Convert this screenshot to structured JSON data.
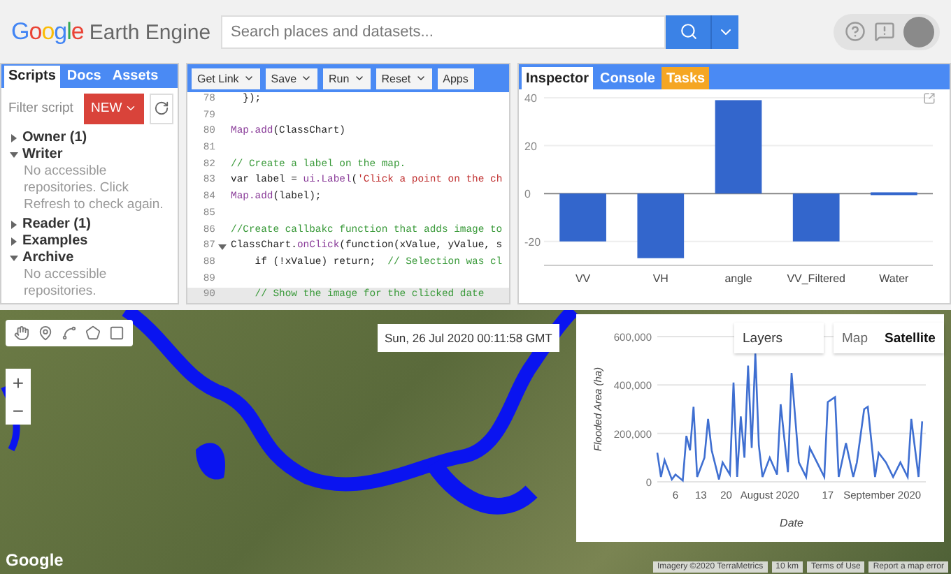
{
  "header": {
    "logo": {
      "brand": "Google",
      "product": "Earth Engine"
    },
    "search": {
      "placeholder": "Search places and datasets..."
    }
  },
  "left_panel": {
    "tabs": [
      {
        "label": "Scripts",
        "selected": true
      },
      {
        "label": "Docs",
        "selected": false
      },
      {
        "label": "Assets",
        "selected": false
      }
    ],
    "filter": {
      "placeholder": "Filter script"
    },
    "new_button": "NEW",
    "tree": [
      {
        "label": "Owner (1)",
        "expanded": false
      },
      {
        "label": "Writer",
        "expanded": true,
        "note": "No accessible repositories. Click Refresh to check again."
      },
      {
        "label": "Reader (1)",
        "expanded": false
      },
      {
        "label": "Examples",
        "expanded": false
      },
      {
        "label": "Archive",
        "expanded": true,
        "note": "No accessible repositories."
      }
    ]
  },
  "editor": {
    "toolbar": [
      {
        "label": "Get Link",
        "dropdown": true
      },
      {
        "label": "Save",
        "dropdown": true
      },
      {
        "label": "Run",
        "dropdown": true
      },
      {
        "label": "Reset",
        "dropdown": true
      },
      {
        "label": "Apps",
        "dropdown": false
      }
    ],
    "lines": [
      {
        "num": "78",
        "segments": [
          {
            "text": "  });",
            "kind": "plain"
          }
        ]
      },
      {
        "num": "79"
      },
      {
        "num": "80",
        "segments": [
          {
            "text": "Map.add",
            "kind": "builtin"
          },
          {
            "text": "(ClassChart)",
            "kind": "plain"
          }
        ]
      },
      {
        "num": "81"
      },
      {
        "num": "82",
        "segments": [
          {
            "text": "// Create a label on the map.",
            "kind": "comment"
          }
        ]
      },
      {
        "num": "83",
        "segments": [
          {
            "text": "var label = ",
            "kind": "plain"
          },
          {
            "text": "ui.Label",
            "kind": "builtin"
          },
          {
            "text": "(",
            "kind": "plain"
          },
          {
            "text": "'Click a point on the ch",
            "kind": "string"
          }
        ]
      },
      {
        "num": "84",
        "segments": [
          {
            "text": "Map.add",
            "kind": "builtin"
          },
          {
            "text": "(label);",
            "kind": "plain"
          }
        ]
      },
      {
        "num": "85"
      },
      {
        "num": "86",
        "segments": [
          {
            "text": "//Create callbakc function that adds image to",
            "kind": "comment"
          }
        ]
      },
      {
        "num": "87",
        "foldable": true,
        "segments": [
          {
            "text": "ClassChart.",
            "kind": "plain"
          },
          {
            "text": "onClick",
            "kind": "builtin"
          },
          {
            "text": "(function(xValue, yValue, s",
            "kind": "plain"
          }
        ]
      },
      {
        "num": "88",
        "segments": [
          {
            "text": "    if (!xValue) return;  ",
            "kind": "plain"
          },
          {
            "text": "// Selection was cl",
            "kind": "comment"
          }
        ]
      },
      {
        "num": "89"
      },
      {
        "num": "90",
        "current": true,
        "segments": [
          {
            "text": "    // Show the image for the clicked date",
            "kind": "comment"
          }
        ]
      }
    ]
  },
  "right_panel": {
    "tabs": [
      {
        "label": "Inspector",
        "selected": true,
        "alert": false
      },
      {
        "label": "Console",
        "selected": false,
        "alert": false
      },
      {
        "label": "Tasks",
        "selected": false,
        "alert": true
      }
    ],
    "chart_data": {
      "type": "bar",
      "categories": [
        "VV",
        "VH",
        "angle",
        "VV_Filtered",
        "Water"
      ],
      "values": [
        -20,
        -27,
        39,
        -20,
        0.5
      ],
      "ylim": [
        -30,
        40
      ],
      "yticks": [
        -20,
        0,
        20,
        40
      ]
    }
  },
  "map": {
    "date": "Sun, 26 Jul 2020 00:11:58 GMT",
    "zoom_in": "+",
    "zoom_out": "−",
    "layers": "Layers",
    "map_types": [
      {
        "label": "Map",
        "selected": false
      },
      {
        "label": "Satellite",
        "selected": true
      }
    ],
    "google_logo": "Google",
    "attribution": [
      "Imagery ©2020 TerraMetrics",
      "10 km",
      "Terms of Use",
      "Report a map error"
    ],
    "chart_data": {
      "type": "line",
      "xlabel": "Date",
      "ylabel": "Flooded Area (ha)",
      "x": [
        "2020-07-01",
        "2020-07-02",
        "2020-07-03",
        "2020-07-05",
        "2020-07-06",
        "2020-07-08",
        "2020-07-09",
        "2020-07-10",
        "2020-07-11",
        "2020-07-12",
        "2020-07-14",
        "2020-07-15",
        "2020-07-16",
        "2020-07-18",
        "2020-07-19",
        "2020-07-21",
        "2020-07-22",
        "2020-07-23",
        "2020-07-24",
        "2020-07-25",
        "2020-07-26",
        "2020-07-27",
        "2020-07-28",
        "2020-07-29",
        "2020-07-30",
        "2020-08-01",
        "2020-08-03",
        "2020-08-04",
        "2020-08-06",
        "2020-08-07",
        "2020-08-09",
        "2020-08-11",
        "2020-08-12",
        "2020-08-14",
        "2020-08-16",
        "2020-08-17",
        "2020-08-19",
        "2020-08-20",
        "2020-08-22",
        "2020-08-24",
        "2020-08-25",
        "2020-08-27",
        "2020-08-28",
        "2020-08-30",
        "2020-08-31",
        "2020-09-02",
        "2020-09-04",
        "2020-09-06",
        "2020-09-08",
        "2020-09-09",
        "2020-09-11",
        "2020-09-12"
      ],
      "series": [
        {
          "color": "#3f6fd1",
          "values": [
            120000,
            20000,
            90000,
            10000,
            30000,
            5000,
            190000,
            130000,
            310000,
            20000,
            100000,
            260000,
            130000,
            10000,
            80000,
            30000,
            410000,
            20000,
            270000,
            100000,
            480000,
            140000,
            530000,
            150000,
            20000,
            100000,
            30000,
            320000,
            40000,
            450000,
            80000,
            20000,
            140000,
            80000,
            20000,
            330000,
            350000,
            20000,
            160000,
            20000,
            80000,
            300000,
            310000,
            20000,
            120000,
            80000,
            20000,
            80000,
            20000,
            260000,
            20000,
            250000
          ]
        }
      ],
      "xlim": [
        "2020-07-01",
        "2020-09-13"
      ],
      "ylim": [
        0,
        600000
      ],
      "xticks": [
        {
          "value": "2020-07-06",
          "label": "6"
        },
        {
          "value": "2020-07-13",
          "label": "13"
        },
        {
          "value": "2020-07-20",
          "label": "20"
        },
        {
          "value": "2020-08-01",
          "label": "August 2020"
        },
        {
          "value": "2020-08-17",
          "label": "17"
        },
        {
          "value": "2020-09-01",
          "label": "September 2020"
        }
      ],
      "yticks": [
        {
          "value": 0,
          "label": "0"
        },
        {
          "value": 200000,
          "label": "200,000"
        },
        {
          "value": 400000,
          "label": "400,000"
        },
        {
          "value": 600000,
          "label": "600,000"
        }
      ]
    }
  }
}
